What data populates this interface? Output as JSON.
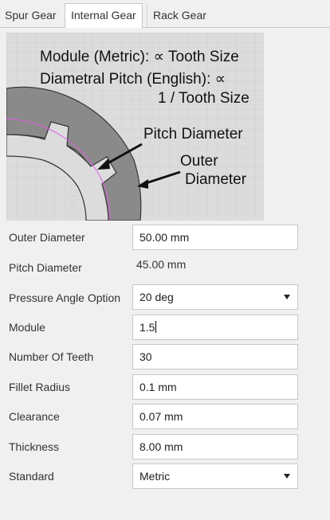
{
  "tabs": [
    {
      "label": "Spur Gear"
    },
    {
      "label": "Internal Gear"
    },
    {
      "label": "Rack Gear"
    }
  ],
  "diagram": {
    "line1": "Module (Metric): ∝ Tooth Size",
    "line2": "Diametral Pitch (English): ∝",
    "line3": "1 / Tooth Size",
    "pitch_label": "Pitch Diameter",
    "outer_label_1": "Outer",
    "outer_label_2": "Diameter"
  },
  "form": {
    "outer_diameter": {
      "label": "Outer Diameter",
      "value": "50.00 mm"
    },
    "pitch_diameter": {
      "label": "Pitch Diameter",
      "value": "45.00 mm"
    },
    "pressure_angle": {
      "label": "Pressure Angle Option",
      "value": "20 deg"
    },
    "module": {
      "label": "Module",
      "value": "1.5"
    },
    "teeth": {
      "label": "Number Of Teeth",
      "value": "30"
    },
    "fillet": {
      "label": "Fillet Radius",
      "value": "0.1 mm"
    },
    "clearance": {
      "label": "Clearance",
      "value": "0.07 mm"
    },
    "thickness": {
      "label": "Thickness",
      "value": "8.00 mm"
    },
    "standard": {
      "label": "Standard",
      "value": "Metric"
    }
  }
}
